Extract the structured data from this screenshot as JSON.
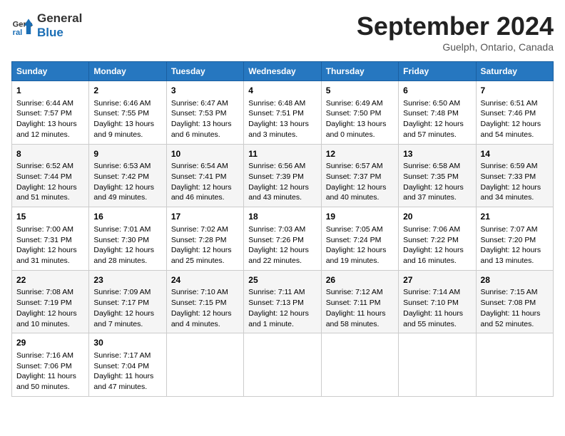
{
  "logo": {
    "line1": "General",
    "line2": "Blue"
  },
  "title": "September 2024",
  "location": "Guelph, Ontario, Canada",
  "weekdays": [
    "Sunday",
    "Monday",
    "Tuesday",
    "Wednesday",
    "Thursday",
    "Friday",
    "Saturday"
  ],
  "weeks": [
    [
      {
        "day": "1",
        "sunrise": "6:44 AM",
        "sunset": "7:57 PM",
        "daylight": "13 hours and 12 minutes."
      },
      {
        "day": "2",
        "sunrise": "6:46 AM",
        "sunset": "7:55 PM",
        "daylight": "13 hours and 9 minutes."
      },
      {
        "day": "3",
        "sunrise": "6:47 AM",
        "sunset": "7:53 PM",
        "daylight": "13 hours and 6 minutes."
      },
      {
        "day": "4",
        "sunrise": "6:48 AM",
        "sunset": "7:51 PM",
        "daylight": "13 hours and 3 minutes."
      },
      {
        "day": "5",
        "sunrise": "6:49 AM",
        "sunset": "7:50 PM",
        "daylight": "13 hours and 0 minutes."
      },
      {
        "day": "6",
        "sunrise": "6:50 AM",
        "sunset": "7:48 PM",
        "daylight": "12 hours and 57 minutes."
      },
      {
        "day": "7",
        "sunrise": "6:51 AM",
        "sunset": "7:46 PM",
        "daylight": "12 hours and 54 minutes."
      }
    ],
    [
      {
        "day": "8",
        "sunrise": "6:52 AM",
        "sunset": "7:44 PM",
        "daylight": "12 hours and 51 minutes."
      },
      {
        "day": "9",
        "sunrise": "6:53 AM",
        "sunset": "7:42 PM",
        "daylight": "12 hours and 49 minutes."
      },
      {
        "day": "10",
        "sunrise": "6:54 AM",
        "sunset": "7:41 PM",
        "daylight": "12 hours and 46 minutes."
      },
      {
        "day": "11",
        "sunrise": "6:56 AM",
        "sunset": "7:39 PM",
        "daylight": "12 hours and 43 minutes."
      },
      {
        "day": "12",
        "sunrise": "6:57 AM",
        "sunset": "7:37 PM",
        "daylight": "12 hours and 40 minutes."
      },
      {
        "day": "13",
        "sunrise": "6:58 AM",
        "sunset": "7:35 PM",
        "daylight": "12 hours and 37 minutes."
      },
      {
        "day": "14",
        "sunrise": "6:59 AM",
        "sunset": "7:33 PM",
        "daylight": "12 hours and 34 minutes."
      }
    ],
    [
      {
        "day": "15",
        "sunrise": "7:00 AM",
        "sunset": "7:31 PM",
        "daylight": "12 hours and 31 minutes."
      },
      {
        "day": "16",
        "sunrise": "7:01 AM",
        "sunset": "7:30 PM",
        "daylight": "12 hours and 28 minutes."
      },
      {
        "day": "17",
        "sunrise": "7:02 AM",
        "sunset": "7:28 PM",
        "daylight": "12 hours and 25 minutes."
      },
      {
        "day": "18",
        "sunrise": "7:03 AM",
        "sunset": "7:26 PM",
        "daylight": "12 hours and 22 minutes."
      },
      {
        "day": "19",
        "sunrise": "7:05 AM",
        "sunset": "7:24 PM",
        "daylight": "12 hours and 19 minutes."
      },
      {
        "day": "20",
        "sunrise": "7:06 AM",
        "sunset": "7:22 PM",
        "daylight": "12 hours and 16 minutes."
      },
      {
        "day": "21",
        "sunrise": "7:07 AM",
        "sunset": "7:20 PM",
        "daylight": "12 hours and 13 minutes."
      }
    ],
    [
      {
        "day": "22",
        "sunrise": "7:08 AM",
        "sunset": "7:19 PM",
        "daylight": "12 hours and 10 minutes."
      },
      {
        "day": "23",
        "sunrise": "7:09 AM",
        "sunset": "7:17 PM",
        "daylight": "12 hours and 7 minutes."
      },
      {
        "day": "24",
        "sunrise": "7:10 AM",
        "sunset": "7:15 PM",
        "daylight": "12 hours and 4 minutes."
      },
      {
        "day": "25",
        "sunrise": "7:11 AM",
        "sunset": "7:13 PM",
        "daylight": "12 hours and 1 minute."
      },
      {
        "day": "26",
        "sunrise": "7:12 AM",
        "sunset": "7:11 PM",
        "daylight": "11 hours and 58 minutes."
      },
      {
        "day": "27",
        "sunrise": "7:14 AM",
        "sunset": "7:10 PM",
        "daylight": "11 hours and 55 minutes."
      },
      {
        "day": "28",
        "sunrise": "7:15 AM",
        "sunset": "7:08 PM",
        "daylight": "11 hours and 52 minutes."
      }
    ],
    [
      {
        "day": "29",
        "sunrise": "7:16 AM",
        "sunset": "7:06 PM",
        "daylight": "11 hours and 50 minutes."
      },
      {
        "day": "30",
        "sunrise": "7:17 AM",
        "sunset": "7:04 PM",
        "daylight": "11 hours and 47 minutes."
      },
      null,
      null,
      null,
      null,
      null
    ]
  ]
}
